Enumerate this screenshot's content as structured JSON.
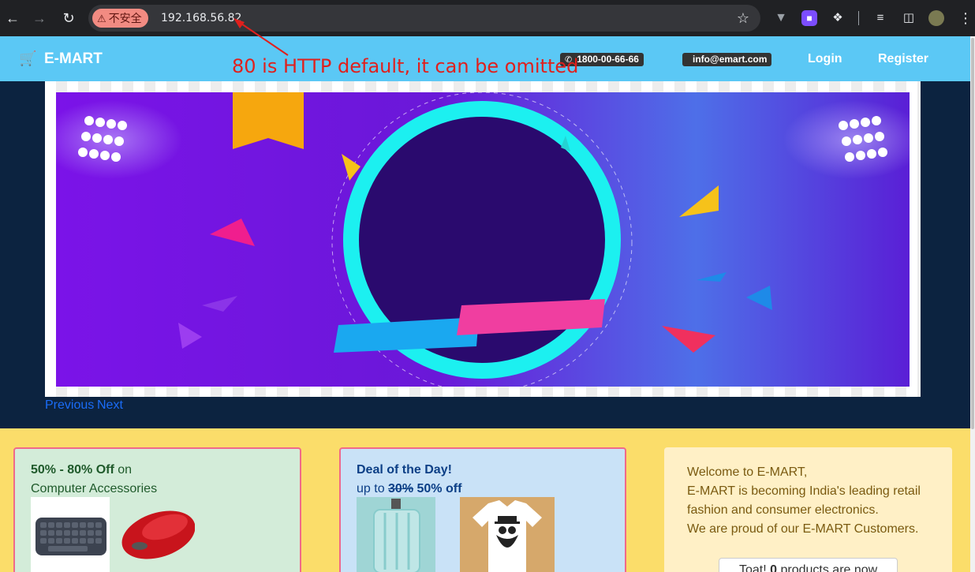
{
  "browser": {
    "security_chip": "不安全",
    "url": "192.168.56.82",
    "icons": [
      "back-icon",
      "forward-icon",
      "reload-icon",
      "warning-icon",
      "star-icon",
      "extension-icon",
      "puzzle-icon",
      "reading-list-icon",
      "side-panel-icon",
      "profile-avatar",
      "kebab-menu-icon"
    ]
  },
  "annotation": {
    "text": "80 is HTTP default, it can be omitted",
    "color": "#e0201d"
  },
  "navbar": {
    "brand": "E-MART",
    "phone": "1800-00-66-66",
    "email": "info@emart.com",
    "login": "Login",
    "register": "Register",
    "bg_color": "#5bc8f5"
  },
  "carousel": {
    "prev": "Previous",
    "next": "Next"
  },
  "offer_card": {
    "bold": "50% - 80% Off",
    "rest": " on",
    "line2": "Computer Accessories"
  },
  "deal_card": {
    "title": "Deal of the Day!",
    "prefix": "up to ",
    "old": "30%",
    "new": " 50% off"
  },
  "welcome": {
    "line1": "Welcome to E-MART,",
    "line2": "E-MART is becoming India's leading retail",
    "line3": "fashion and consumer electronics.",
    "line4": "We are proud of our E-MART Customers.",
    "toast_prefix": "Toat! ",
    "toast_count": "0",
    "toast_suffix": " products are now"
  }
}
